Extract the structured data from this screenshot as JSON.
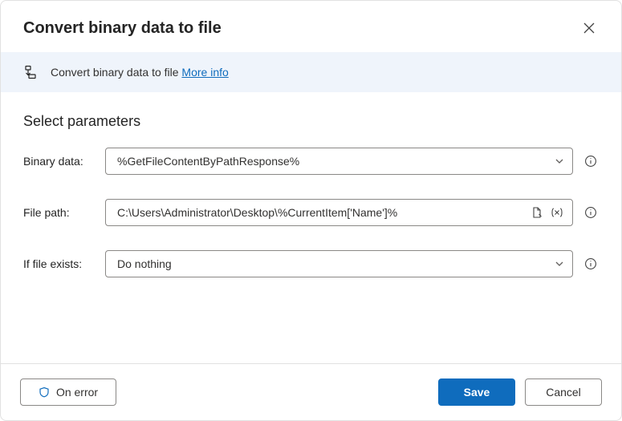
{
  "dialog": {
    "title": "Convert binary data to file",
    "info_desc": "Convert binary data to file",
    "more_info": "More info"
  },
  "section": {
    "heading": "Select parameters"
  },
  "fields": {
    "binary_data": {
      "label": "Binary data:",
      "value": "%GetFileContentByPathResponse%"
    },
    "file_path": {
      "label": "File path:",
      "value": "C:\\Users\\Administrator\\Desktop\\%CurrentItem['Name']%"
    },
    "if_exists": {
      "label": "If file exists:",
      "value": "Do nothing"
    }
  },
  "footer": {
    "on_error": "On error",
    "save": "Save",
    "cancel": "Cancel"
  }
}
